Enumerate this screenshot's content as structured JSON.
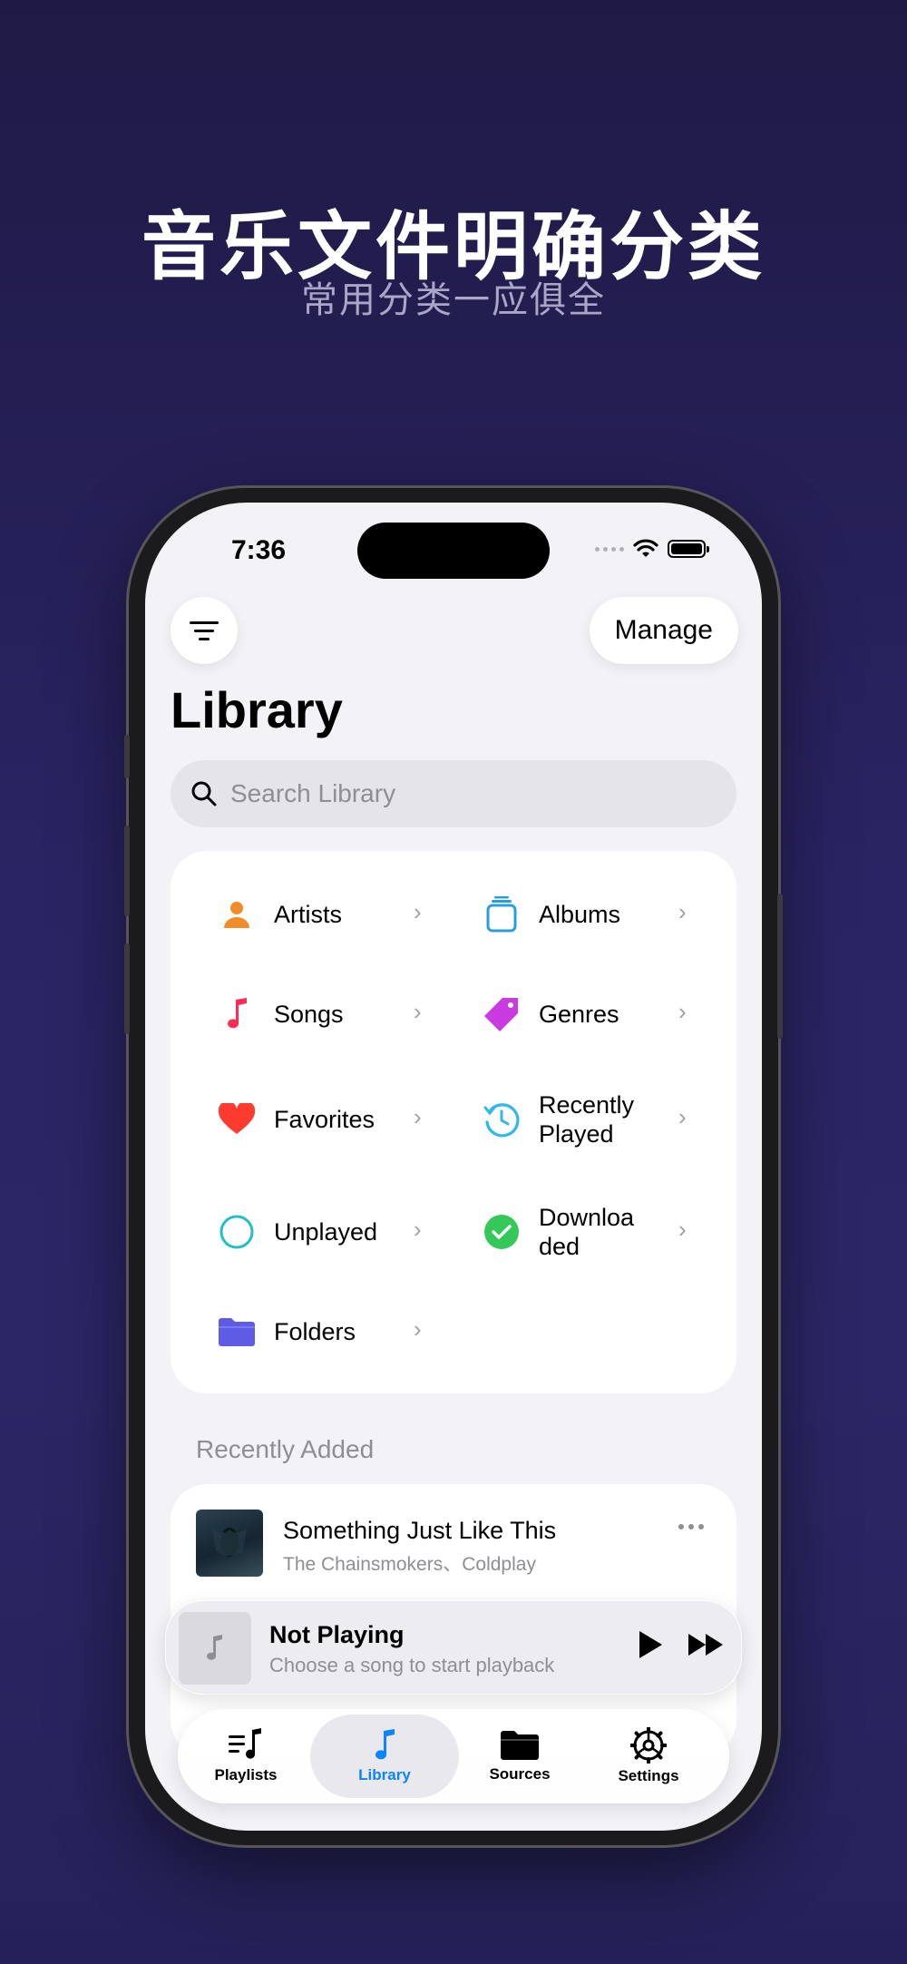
{
  "promo": {
    "headline": "音乐文件明确分类",
    "subheadline": "常用分类一应俱全"
  },
  "status_bar": {
    "time": "7:36"
  },
  "header": {
    "manage_label": "Manage",
    "title": "Library"
  },
  "search": {
    "placeholder": "Search Library"
  },
  "categories": [
    {
      "label": "Artists",
      "icon": "person-icon",
      "color": "#f28c28"
    },
    {
      "label": "Albums",
      "icon": "album-stack-icon",
      "color": "#2d9cdb"
    },
    {
      "label": "Songs",
      "icon": "music-note-icon",
      "color": "#ff2d55"
    },
    {
      "label": "Genres",
      "icon": "tag-icon",
      "color": "#c93ae0"
    },
    {
      "label": "Favorites",
      "icon": "heart-icon",
      "color": "#ff3b30"
    },
    {
      "label": "Recently Played",
      "icon": "history-clock-icon",
      "color": "#32b8e6"
    },
    {
      "label": "Unplayed",
      "icon": "empty-circle-icon",
      "color": "#20c0c8"
    },
    {
      "label": "Downloaded",
      "icon": "checkmark-circle-icon",
      "color": "#34c759"
    },
    {
      "label": "Folders",
      "icon": "folder-icon",
      "color": "#5e5ce6"
    }
  ],
  "recently_added": {
    "title": "Recently Added",
    "items": [
      {
        "title": "Something Just Like This",
        "artist": "The Chainsmokers、Coldplay"
      }
    ]
  },
  "mini_player": {
    "title": "Not Playing",
    "subtitle": "Choose a song to start playback"
  },
  "tabs": [
    {
      "label": "Playlists",
      "icon": "playlist-icon",
      "active": false
    },
    {
      "label": "Library",
      "icon": "music-note-icon",
      "active": true
    },
    {
      "label": "Sources",
      "icon": "folder-icon",
      "active": false
    },
    {
      "label": "Settings",
      "icon": "gear-icon",
      "active": false
    }
  ],
  "colors": {
    "accent": "#0a84ff",
    "background_top": "#1f1a45",
    "background_bottom": "#2b2766"
  }
}
